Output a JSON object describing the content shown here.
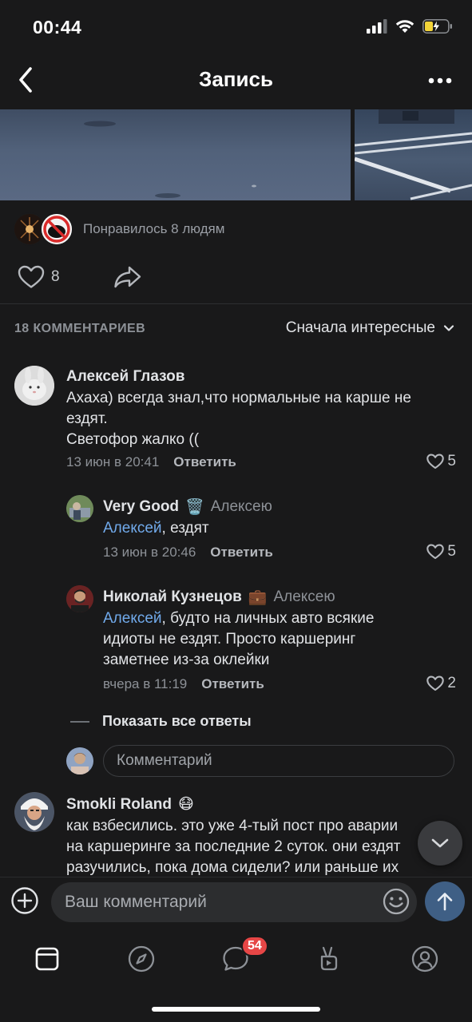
{
  "status_bar": {
    "time": "00:44"
  },
  "nav": {
    "title": "Запись",
    "back_icon": "chevron-left-icon",
    "more_icon": "more-horizontal-icon"
  },
  "likes": {
    "liked_text": "Понравилось 8 людям",
    "like_count": "8"
  },
  "comments_header": {
    "count_label": "18 КОММЕНТАРИЕВ",
    "sort_label": "Сначала интересные"
  },
  "comments": [
    {
      "author": "Алексей Глазов",
      "lines": [
        "Ахаха) всегда знал,что нормальные на карше не",
        "ездят.",
        "Светофор жалко (("
      ],
      "time": "13 июн в 20:41",
      "reply_label": "Ответить",
      "likes": "5"
    },
    {
      "author": "Very Good",
      "author_emoji": "🗑️",
      "reply_to": "Алексею",
      "mention": "Алексей",
      "text": ", ездят",
      "time": "13 июн в 20:46",
      "reply_label": "Ответить",
      "likes": "5"
    },
    {
      "author": "Николай Кузнецов",
      "author_emoji": "💼",
      "reply_to": "Алексею",
      "mention": "Алексей",
      "line1_rest": ", будто на личных авто всякие",
      "line2": "идиоты не ездят. Просто каршеринг",
      "line3": "заметнее из-за оклейки",
      "time": "вчера в 11:19",
      "reply_label": "Ответить",
      "likes": "2"
    },
    {
      "author": "Smokli Roland",
      "author_emoji": "😷",
      "lines": [
        "как взбесились. это уже 4-тый пост про аварии",
        "на каршеринге за последние 2 суток. они ездят",
        "разучились, пока дома сидели? или раньше их"
      ]
    }
  ],
  "show_all_replies": "Показать все ответы",
  "reply_input": {
    "placeholder": "Комментарий"
  },
  "composer": {
    "placeholder": "Ваш комментарий"
  },
  "tab_bar": {
    "messages_badge": "54"
  },
  "colors": {
    "background": "#19191a",
    "accent_link": "#71aaeb",
    "send_button": "#3f5f85",
    "badge": "#e64646"
  }
}
